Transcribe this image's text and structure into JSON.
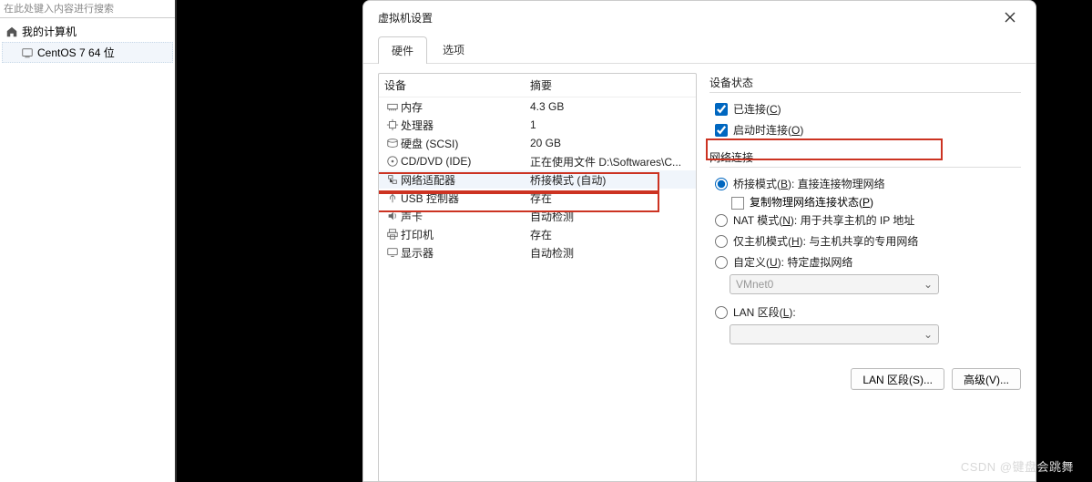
{
  "sidebar": {
    "search_hint": "在此处键入内容进行搜索",
    "root": "我的计算机",
    "child": "CentOS 7 64 位"
  },
  "dialog": {
    "title": "虚拟机设置",
    "tabs": {
      "hardware": "硬件",
      "options": "选项"
    },
    "columns": {
      "device": "设备",
      "summary": "摘要"
    },
    "devices": [
      {
        "icon": "memory-icon",
        "name": "内存",
        "summary": "4.3 GB"
      },
      {
        "icon": "cpu-icon",
        "name": "处理器",
        "summary": "1"
      },
      {
        "icon": "disk-icon",
        "name": "硬盘 (SCSI)",
        "summary": "20 GB"
      },
      {
        "icon": "disc-icon",
        "name": "CD/DVD (IDE)",
        "summary": "正在使用文件 D:\\Softwares\\C..."
      },
      {
        "icon": "network-icon",
        "name": "网络适配器",
        "summary": "桥接模式 (自动)",
        "selected": true
      },
      {
        "icon": "usb-icon",
        "name": "USB 控制器",
        "summary": "存在"
      },
      {
        "icon": "sound-icon",
        "name": "声卡",
        "summary": "自动检测"
      },
      {
        "icon": "printer-icon",
        "name": "打印机",
        "summary": "存在"
      },
      {
        "icon": "display-icon",
        "name": "显示器",
        "summary": "自动检测"
      }
    ],
    "device_status": {
      "title": "设备状态",
      "connected": "已连接(C)",
      "connect_at_power": "启动时连接(O)"
    },
    "net": {
      "title": "网络连接",
      "bridge": "桥接模式(B): 直接连接物理网络",
      "replicate": "复制物理网络连接状态(P)",
      "nat": "NAT 模式(N): 用于共享主机的 IP 地址",
      "hostonly": "仅主机模式(H): 与主机共享的专用网络",
      "custom": "自定义(U): 特定虚拟网络",
      "custom_value": "VMnet0",
      "lan": "LAN 区段(L):",
      "lan_value": ""
    },
    "buttons": {
      "lanseg": "LAN 区段(S)...",
      "adv": "高级(V)..."
    }
  },
  "watermark": "CSDN @键盘会跳舞"
}
